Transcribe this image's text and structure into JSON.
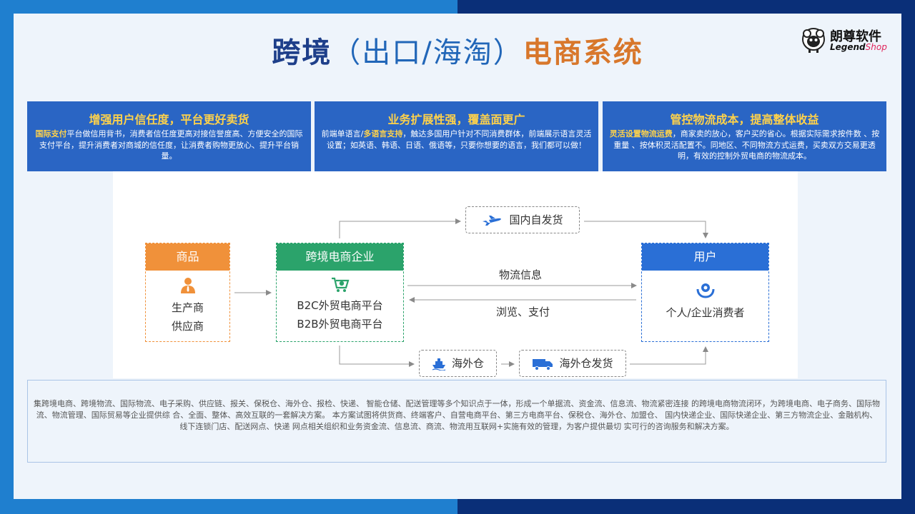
{
  "title": {
    "part1": "跨境",
    "part2": "（出口/海淘）",
    "part3": "电商系统"
  },
  "logo": {
    "cn": "朗尊软件",
    "en_main": "Legend",
    "en_accent": "Shop"
  },
  "features": [
    {
      "heading": "增强用户信任度，平台更好卖货",
      "highlight": "国际支付",
      "text": "平台做信用背书，消费者信任度更高对接信誉度高、方便安全的国际支付平台，提升消费者对商城的信任度，让消费者购物更放心、提升平台销量。"
    },
    {
      "heading": "业务扩展性强，覆盖面更广",
      "pre": "前端单语言/",
      "highlight": "多语言支持",
      "text": "，触达多国用户针对不同消费群体，前端展示语言灵活设置；如英语、韩语、日语、俄语等，只要你想要的语言，我们都可以做！"
    },
    {
      "heading": "管控物流成本，提高整体收益",
      "highlight": "灵活设置物流运费",
      "text": "，商家卖的放心，客户买的省心。根据实际需求按件数 、按重量 、按体积灵活配置不。同地区、不同物流方式运费，买卖双方交易更透明，有效的控制外贸电商的物流成本。"
    }
  ],
  "diagram": {
    "goods": {
      "title": "商品",
      "line1": "生产商",
      "line2": "供应商"
    },
    "corp": {
      "title": "跨境电商企业",
      "line1": "B2C外贸电商平台",
      "line2": "B2B外贸电商平台"
    },
    "user": {
      "title": "用户",
      "line1": "个人/企业消费者"
    },
    "domestic": "国内自发货",
    "warehouse": "海外仓",
    "overseas_ship": "海外仓发货",
    "logistics_info": "物流信息",
    "browse_pay": "浏览、支付"
  },
  "description": "集跨境电商、跨境物流、国际物流、电子采购、供应链、报关、保税仓、海外仓、报检、快递、 智能仓储、配送管理等多个知识点于一体，形成一个单据流、资金流、信息流、物流紧密连接 的跨境电商物流闭环，为跨境电商、电子商务、国际物流、物流管理、国际贸易等企业提供综 合、全面、整体、高效互联的一套解决方案。 本方案试图将供货商、终端客户、自营电商平台、第三方电商平台、保税仓、海外仓、加盟仓、 国内快递企业、国际快递企业、第三方物流企业、金融机构、线下连锁门店、配送网点、快递 网点相关组织和业务资金流、信息流、商流、物流用互联网+实施有效的管理，为客户提供最切 实可行的咨询服务和解决方案。",
  "colors": {
    "orange": "#f0913a",
    "green": "#2ba36b",
    "blue": "#2a6fd6",
    "panel": "#2a65c4",
    "yellow": "#ffd24a"
  }
}
